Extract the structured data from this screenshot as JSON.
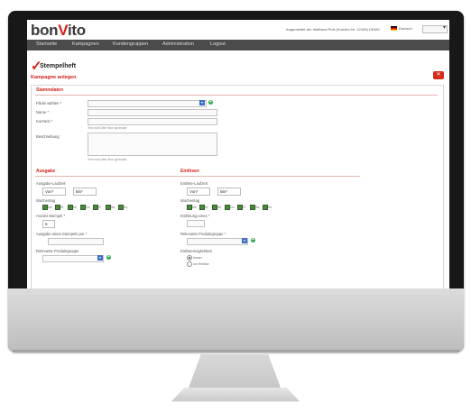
{
  "app": {
    "logo_left": "bon",
    "logo_v": "V",
    "logo_right": "ito"
  },
  "header": {
    "user_info": "Angemeldet als: Waltraud Puls (Kunden-Nr. 12345) DEMO",
    "language": "Deutsch"
  },
  "nav": {
    "items": [
      "Startseite",
      "Kampagnen",
      "Kundengruppen",
      "Administration",
      "Logout"
    ]
  },
  "page": {
    "title": "Stempelheft",
    "subtitle": "Kampagne anlegen"
  },
  "stammdaten": {
    "title": "Stammdaten",
    "filiale_label": "Filiale wählen *",
    "name_label": "Name *",
    "kurztext_label": "Kurztext *",
    "kurztext_hint": "Text wird über Bon gedruckt",
    "beschreibung_label": "Beschreibung",
    "beschreibung_hint": "Text wird über Bon gedruckt"
  },
  "ausgabe": {
    "title": "Ausgabe",
    "laufzeit_label": "Ausgabe-Laufzeit",
    "von": "Von*",
    "bis": "Bis*",
    "wochentag_label": "Wochentag",
    "days": [
      "Mo",
      "Di",
      "Mi",
      "Do",
      "Fr",
      "Sa",
      "So"
    ],
    "anzahl_label": "Anzahl Stempel *",
    "anzahl_value": "6",
    "stempel_per_label": "Ausgabe eines Stempels per *",
    "produktgruppe_label": "Relevante Produktgruppe"
  },
  "einloesen": {
    "title": "Einlösen",
    "laufzeit_label": "Einlöse-Laufzeit",
    "von": "Von*",
    "bis": "Bis*",
    "wochentag_label": "Wochentag",
    "days": [
      "Mo",
      "Di",
      "Mi",
      "Do",
      "Fr",
      "Sa",
      "So"
    ],
    "einloesung_label": "Einlösung eines *",
    "produktgruppe_label": "Relevante Produktgruppe *",
    "gueltigkeit_label": "Einlösemöglichkeit",
    "radio_1": "Immer",
    "radio_2": "nur Einlöse"
  }
}
